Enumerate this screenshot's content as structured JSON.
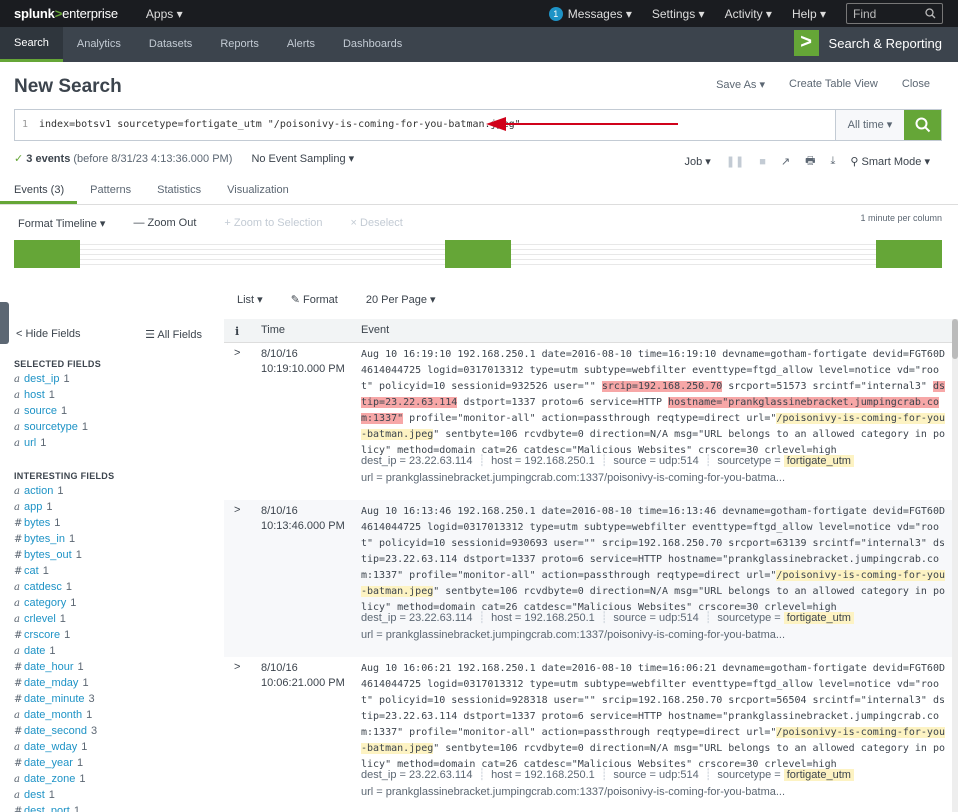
{
  "top": {
    "logo_1": "splunk",
    "logo_2": ">",
    "logo_3": "enterprise",
    "apps": "Apps ▾",
    "msg_count": "1",
    "messages": "Messages ▾",
    "settings": "Settings ▾",
    "activity": "Activity ▾",
    "help": "Help ▾",
    "find_placeholder": "Find"
  },
  "appbar": {
    "tabs": [
      "Search",
      "Analytics",
      "Datasets",
      "Reports",
      "Alerts",
      "Dashboards"
    ],
    "brand": "Search & Reporting",
    "brand_icon": ">"
  },
  "page": {
    "title": "New Search",
    "save_as": "Save As ▾",
    "create_table": "Create Table View",
    "close": "Close"
  },
  "search": {
    "line_no": "1",
    "query": "index=botsv1 sourcetype=fortigate_utm \"/poisonivy-is-coming-for-you-batman.jpeg\"",
    "time_range": "All time ▾",
    "search_icon": "search-icon"
  },
  "status": {
    "check": "✓",
    "count": "3 events",
    "before": "(before 8/31/23 4:13:36.000 PM)",
    "sampling": "No Event Sampling ▾",
    "job": "Job ▾",
    "pause": "❚❚",
    "stop": "■",
    "share": "↗",
    "print": "🖶",
    "export": "⤓",
    "mode": "⚲ Smart Mode ▾"
  },
  "tabs": [
    "Events (3)",
    "Patterns",
    "Statistics",
    "Visualization"
  ],
  "timeline": {
    "format": "Format Timeline ▾",
    "zoom_out": "— Zoom Out",
    "zoom_sel": "+ Zoom to Selection",
    "deselect": "× Deselect",
    "scale": "1 minute per column",
    "bars": [
      0.0,
      0.5,
      1.0
    ]
  },
  "list_controls": {
    "list": "List ▾",
    "format": "✎ Format",
    "per_page": "20 Per Page ▾"
  },
  "fields": {
    "hide": "< Hide Fields",
    "all": "☰ All Fields",
    "selected_title": "SELECTED FIELDS",
    "selected": [
      {
        "type": "a",
        "name": "dest_ip",
        "count": "1"
      },
      {
        "type": "a",
        "name": "host",
        "count": "1"
      },
      {
        "type": "a",
        "name": "source",
        "count": "1"
      },
      {
        "type": "a",
        "name": "sourcetype",
        "count": "1"
      },
      {
        "type": "a",
        "name": "url",
        "count": "1"
      }
    ],
    "interesting_title": "INTERESTING FIELDS",
    "interesting": [
      {
        "type": "a",
        "name": "action",
        "count": "1"
      },
      {
        "type": "a",
        "name": "app",
        "count": "1"
      },
      {
        "type": "#",
        "name": "bytes",
        "count": "1"
      },
      {
        "type": "#",
        "name": "bytes_in",
        "count": "1"
      },
      {
        "type": "#",
        "name": "bytes_out",
        "count": "1"
      },
      {
        "type": "#",
        "name": "cat",
        "count": "1"
      },
      {
        "type": "a",
        "name": "catdesc",
        "count": "1"
      },
      {
        "type": "a",
        "name": "category",
        "count": "1"
      },
      {
        "type": "a",
        "name": "crlevel",
        "count": "1"
      },
      {
        "type": "#",
        "name": "crscore",
        "count": "1"
      },
      {
        "type": "a",
        "name": "date",
        "count": "1"
      },
      {
        "type": "#",
        "name": "date_hour",
        "count": "1"
      },
      {
        "type": "#",
        "name": "date_mday",
        "count": "1"
      },
      {
        "type": "#",
        "name": "date_minute",
        "count": "3"
      },
      {
        "type": "a",
        "name": "date_month",
        "count": "1"
      },
      {
        "type": "#",
        "name": "date_second",
        "count": "3"
      },
      {
        "type": "a",
        "name": "date_wday",
        "count": "1"
      },
      {
        "type": "#",
        "name": "date_year",
        "count": "1"
      },
      {
        "type": "a",
        "name": "date_zone",
        "count": "1"
      },
      {
        "type": "a",
        "name": "dest",
        "count": "1"
      },
      {
        "type": "#",
        "name": "dest_port",
        "count": "1"
      }
    ]
  },
  "events_header": {
    "i": "i",
    "time": "Time",
    "event": "Event"
  },
  "events": [
    {
      "date": "8/10/16",
      "time": "10:19:10.000 PM",
      "raw": [
        {
          "t": "Aug 10 16:19:10 192.168.250.1 date=2016-08-10 time=16:19:10 devname=gotham-fortigate devid=FGT60D4614044725 logid=0317013312 type=utm subtype=webfilter eventtype=ftgd_allow level=notice vd=\"root\" policyid=10 sessionid=932526 user=\"\" ",
          "h": ""
        },
        {
          "t": "srcip=192.168.250.70",
          "h": "red"
        },
        {
          "t": " srcport=51573 srcintf=\"internal3\" ",
          "h": ""
        },
        {
          "t": "dstip=23.22.63.114",
          "h": "red"
        },
        {
          "t": " dstport=1337 proto=6 service=HTTP ",
          "h": ""
        },
        {
          "t": "hostname=\"prankglassinebracket.jumpingcrab.com:1337\"",
          "h": "red"
        },
        {
          "t": " profile=\"monitor-all\" action=passthrough reqtype=direct url=\"",
          "h": ""
        },
        {
          "t": "/poisonivy-is-coming-for-you-batman.jpeg",
          "h": "yel"
        },
        {
          "t": "\" sentbyte=106 rcvdbyte=0 direction=N/A msg=\"URL belongs to an allowed category in policy\" method=domain cat=26 catdesc=\"Malicious Websites\" crscore=30 crlevel=high",
          "h": ""
        }
      ],
      "dest_ip": "23.22.63.114",
      "host": "192.168.250.1",
      "source": "udp:514",
      "sourcetype": "fortigate_utm",
      "url": "prankglassinebracket.jumpingcrab.com:1337/poisonivy-is-coming-for-you-batma..."
    },
    {
      "date": "8/10/16",
      "time": "10:13:46.000 PM",
      "raw": [
        {
          "t": "Aug 10 16:13:46 192.168.250.1 date=2016-08-10 time=16:13:46 devname=gotham-fortigate devid=FGT60D4614044725 logid=0317013312 type=utm subtype=webfilter eventtype=ftgd_allow level=notice vd=\"root\" policyid=10 sessionid=930693 user=\"\" srcip=192.168.250.70 srcport=63139 srcintf=\"internal3\" dstip=23.22.63.114 dstport=1337 proto=6 service=HTTP hostname=\"prankglassinebracket.jumpingcrab.com:1337\" profile=\"monitor-all\" action=passthrough reqtype=direct url=\"",
          "h": ""
        },
        {
          "t": "/poisonivy-is-coming-for-you-batman.jpeg",
          "h": "yel"
        },
        {
          "t": "\" sentbyte=106 rcvdbyte=0 direction=N/A msg=\"URL belongs to an allowed category in policy\" method=domain cat=26 catdesc=\"Malicious Websites\" crscore=30 crlevel=high",
          "h": ""
        }
      ],
      "dest_ip": "23.22.63.114",
      "host": "192.168.250.1",
      "source": "udp:514",
      "sourcetype": "fortigate_utm",
      "url": "prankglassinebracket.jumpingcrab.com:1337/poisonivy-is-coming-for-you-batma..."
    },
    {
      "date": "8/10/16",
      "time": "10:06:21.000 PM",
      "raw": [
        {
          "t": "Aug 10 16:06:21 192.168.250.1 date=2016-08-10 time=16:06:21 devname=gotham-fortigate devid=FGT60D4614044725 logid=0317013312 type=utm subtype=webfilter eventtype=ftgd_allow level=notice vd=\"root\" policyid=10 sessionid=928318 user=\"\" srcip=192.168.250.70 srcport=56504 srcintf=\"internal3\" dstip=23.22.63.114 dstport=1337 proto=6 service=HTTP hostname=\"prankglassinebracket.jumpingcrab.com:1337\" profile=\"monitor-all\" action=passthrough reqtype=direct url=\"",
          "h": ""
        },
        {
          "t": "/poisonivy-is-coming-for-you-batman.jpeg",
          "h": "yel"
        },
        {
          "t": "\" sentbyte=106 rcvdbyte=0 direction=N/A msg=\"URL belongs to an allowed category in policy\" method=domain cat=26 catdesc=\"Malicious Websites\" crscore=30 crlevel=high",
          "h": ""
        }
      ],
      "dest_ip": "23.22.63.114",
      "host": "192.168.250.1",
      "source": "udp:514",
      "sourcetype": "fortigate_utm",
      "url": "prankglassinebracket.jumpingcrab.com:1337/poisonivy-is-coming-for-you-batma..."
    }
  ],
  "field_labels": {
    "dest_ip": "dest_ip",
    "host": "host",
    "source": "source",
    "sourcetype": "sourcetype",
    "url": "url"
  },
  "colors": {
    "accent": "#65a637",
    "link": "#1e93c6",
    "highlight_red": "#f7a7a7",
    "highlight_yellow": "#fdf3c3",
    "arrow": "#d0021b"
  }
}
